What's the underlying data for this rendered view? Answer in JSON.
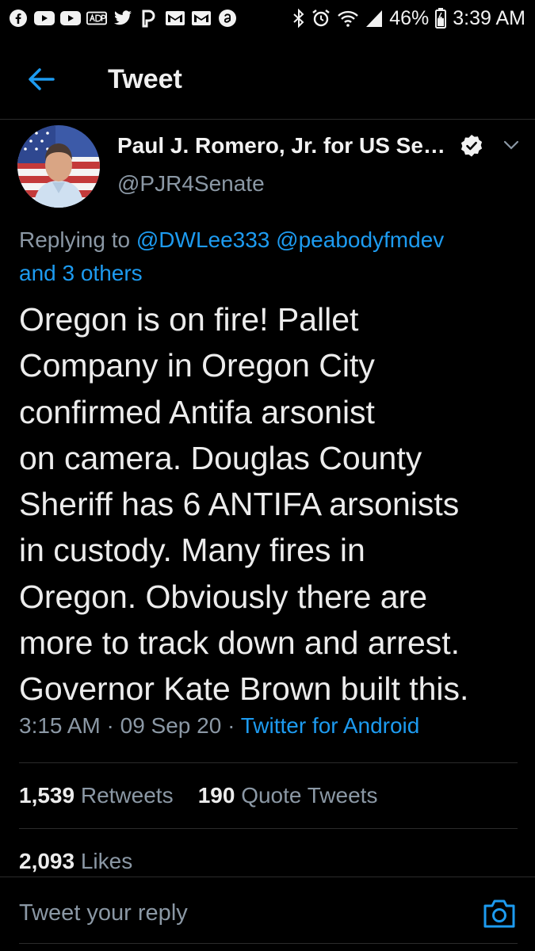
{
  "status_bar": {
    "battery": "46%",
    "time": "3:39 AM",
    "left_icons": [
      "facebook-icon",
      "youtube-icon",
      "youtube-icon",
      "adp-icon",
      "twitter-icon",
      "pandora-icon",
      "gmail-icon",
      "gmail-icon",
      "amazon-icon"
    ],
    "right_icons": [
      "bluetooth-icon",
      "alarm-icon",
      "wifi-icon",
      "signal-icon",
      "battery-icon"
    ]
  },
  "app_bar": {
    "title": "Tweet"
  },
  "author": {
    "name": "Paul J. Romero, Jr. for US Se…",
    "handle": "@PJR4Senate",
    "verified": true
  },
  "replying": {
    "prefix": "Replying to",
    "mention_1": "@DWLee333",
    "mention_2": "@peabodyfmdev",
    "others": "and 3 others"
  },
  "tweet": {
    "text": "Oregon is on fire!  Pallet\nCompany in Oregon City\nconfirmed Antifa arsonist\non camera. Douglas County\nSheriff has 6 ANTIFA arsonists\nin custody. Many fires in\nOregon. Obviously there are\nmore to track down and arrest.\nGovernor Kate Brown built this."
  },
  "meta": {
    "time": "3:15 AM",
    "separator": "·",
    "date": "09 Sep 20",
    "source": "Twitter for Android"
  },
  "stats": {
    "retweets_count": "1,539",
    "retweets_label": "Retweets",
    "quotes_count": "190",
    "quotes_label": "Quote Tweets",
    "likes_count": "2,093",
    "likes_label": "Likes"
  },
  "reply_bar": {
    "placeholder": "Tweet your reply"
  },
  "colors": {
    "accent": "#1d9bf0",
    "muted": "#8b98a5",
    "background": "#000000"
  }
}
